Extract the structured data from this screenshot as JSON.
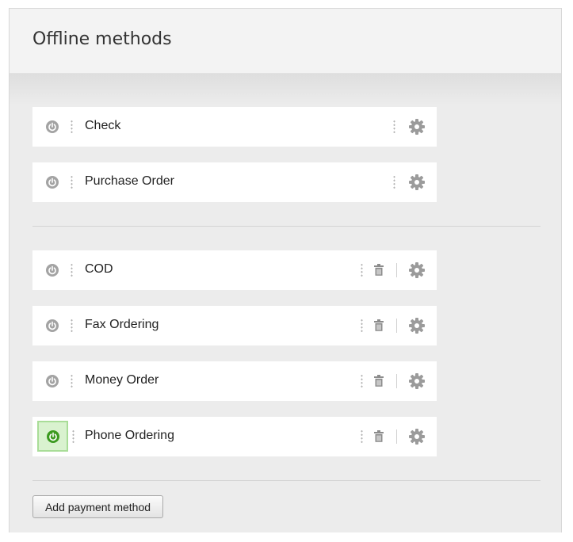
{
  "panel": {
    "title": "Offline methods"
  },
  "rows": [
    {
      "label": "Check",
      "active": false,
      "removable": false
    },
    {
      "label": "Purchase Order",
      "active": false,
      "removable": false
    },
    {
      "label": "COD",
      "active": false,
      "removable": true
    },
    {
      "label": "Fax Ordering",
      "active": false,
      "removable": true
    },
    {
      "label": "Money Order",
      "active": false,
      "removable": true
    },
    {
      "label": "Phone Ordering",
      "active": true,
      "removable": true
    }
  ],
  "add_button": {
    "label": "Add payment method"
  },
  "icons": {
    "power": "power-icon",
    "drag": "drag-handle-icon",
    "trash": "trash-icon",
    "settings": "gear-icon"
  },
  "colors": {
    "power_inactive": "#a3a3a3",
    "power_active": "#3b9a1f",
    "active_bg": "#d9f2cf",
    "active_border": "#a9dd98",
    "gear": "#9b9b9b"
  }
}
